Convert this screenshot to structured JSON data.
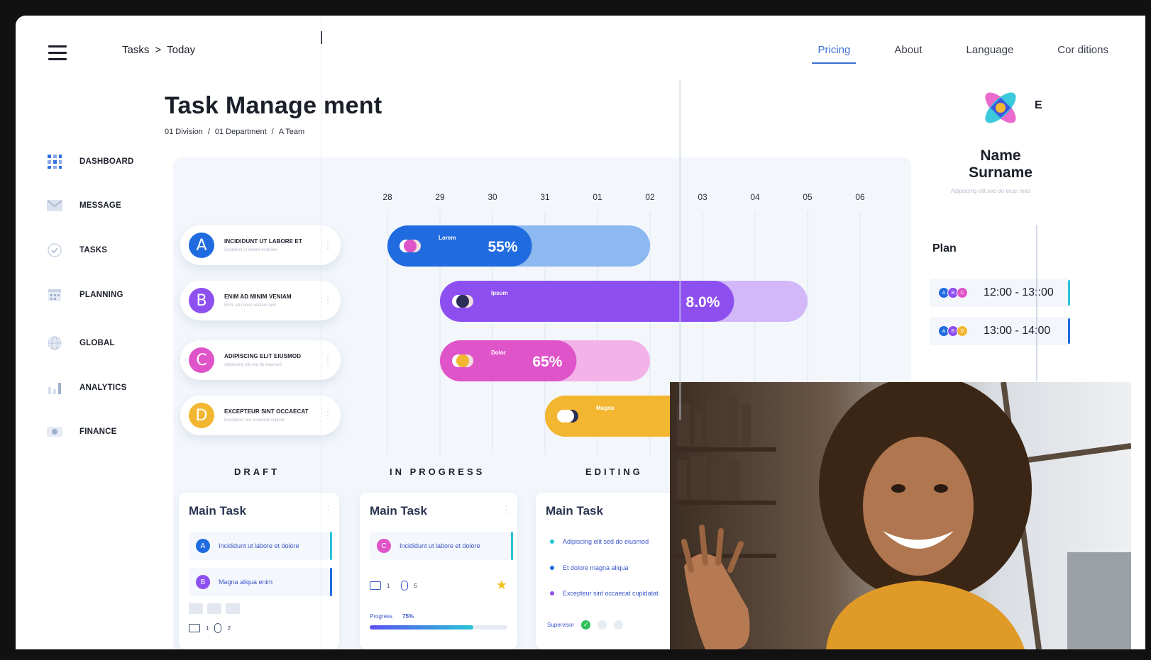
{
  "header": {
    "breadcrumb": [
      "Tasks",
      ">",
      "Today"
    ],
    "nav": [
      {
        "label": "Pricing",
        "active": true
      },
      {
        "label": "About",
        "active": false
      },
      {
        "label": "Language",
        "active": false
      },
      {
        "label": "Cor ditions",
        "active": false
      }
    ]
  },
  "page": {
    "title": "Task Manage ment",
    "breadcrumb": [
      "01 Division",
      "/",
      "01 Department",
      "/",
      "A Team"
    ]
  },
  "sidebar": {
    "items": [
      {
        "label": "DASHBOARD",
        "icon": "grid-icon"
      },
      {
        "label": "MESSAGE",
        "icon": "envelope-icon"
      },
      {
        "label": "TASKS",
        "icon": "check-circle-icon"
      },
      {
        "label": "PLANNING",
        "icon": "calendar-icon"
      },
      {
        "label": "GLOBAL",
        "icon": "globe-icon"
      },
      {
        "label": "ANALYTICS",
        "icon": "bar-chart-icon"
      },
      {
        "label": "FINANCE",
        "icon": "money-icon"
      }
    ]
  },
  "gantt": {
    "dates": [
      "28",
      "29",
      "30",
      "31",
      "01",
      "02",
      "03",
      "04",
      "05",
      "06"
    ],
    "tasks": [
      {
        "letter": "A",
        "title": "INCIDIDUNT UT LABORE ET",
        "sub": "incididunt ut labore et dolore",
        "color": "#1f6bdf"
      },
      {
        "letter": "B",
        "title": "ENIM AD MINIM VENIAM",
        "sub": "Enim ad minim veniam quis",
        "color": "#8e4ff0"
      },
      {
        "letter": "C",
        "title": "ADIPISCING ELIT EIUSMOD",
        "sub": "Adipiscing elit sed do eiusmod",
        "color": "#e054c9"
      },
      {
        "letter": "D",
        "title": "EXCEPTEUR SINT OCCAECAT",
        "sub": "Excepteur sint occaecat cupidat",
        "color": "#f2b630"
      }
    ],
    "bars": [
      {
        "label": "Lorem",
        "percent": "55%",
        "progress": 0.55,
        "color": "#1f6bdf",
        "light": "#8db8f0"
      },
      {
        "label": "Ipsum",
        "percent": "8.0%",
        "progress": 0.8,
        "color": "#8e4ff0",
        "light": "#d2b8f8"
      },
      {
        "label": "Dolor",
        "percent": "65%",
        "progress": 0.65,
        "color": "#e054c9",
        "light": "#f3b3e8"
      },
      {
        "label": "Magna",
        "percent": "",
        "progress": 1.0,
        "color": "#f2b630",
        "light": "#f2b630"
      }
    ]
  },
  "kanban": {
    "columns": [
      "DRAFT",
      "IN PROGRESS",
      "EDITING"
    ],
    "draft": {
      "title": "Main Task",
      "items": [
        {
          "letter": "A",
          "text": "Incididunt ut labore et dolore",
          "color": "#1f6bdf",
          "bar": "#27c3d8"
        },
        {
          "letter": "B",
          "text": "Magna aliqua enim",
          "color": "#8e4ff0",
          "bar": "#1f6bdf"
        }
      ],
      "meta": [
        "1",
        "2"
      ]
    },
    "progress": {
      "title": "Main Task",
      "item": {
        "letter": "C",
        "text": "Incididunt ut labore et dolore",
        "color": "#e054c9",
        "bar": "#27c3d8"
      },
      "comments": "1",
      "attachments": "5",
      "progress_label": "Progress",
      "progress_value": "75%",
      "progress": 0.75
    },
    "editing": {
      "title": "Main Task",
      "bullets": [
        {
          "text": "Adipiscing elit sed do eiusmod",
          "color": "#27c3d8"
        },
        {
          "text": "Et dolore magna aliqua",
          "color": "#1f6bdf"
        },
        {
          "text": "Excepteur sint occaecat cupidatat",
          "color": "#8e4ff0"
        }
      ],
      "supervisor": "Supervisor"
    }
  },
  "profile": {
    "initial": "E",
    "name": "Name Surname",
    "subtitle": "Adipiscing elit sed do eiusı mod",
    "plan_label": "Plan",
    "plan": [
      {
        "time": "12:00 - 13::00",
        "chips": [
          "A",
          "B",
          "C"
        ],
        "edge": "#27c3d8"
      },
      {
        "time": "13:00 - 14:00",
        "chips": [
          "A",
          "B",
          "D"
        ],
        "edge": "#1f6bdf"
      }
    ]
  },
  "colors": {
    "accent": "#3b6fd4",
    "blue": "#1f6bdf",
    "purple": "#8e4ff0",
    "pink": "#e054c9",
    "yellow": "#f2b630",
    "cyan": "#27c3d8"
  }
}
